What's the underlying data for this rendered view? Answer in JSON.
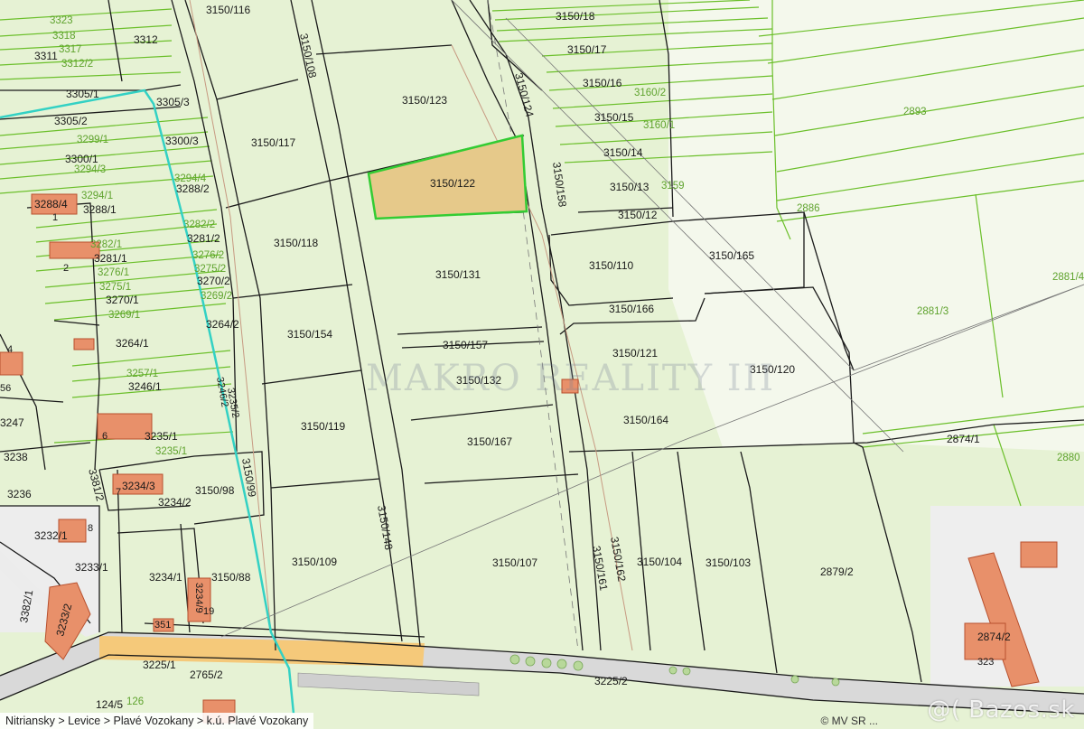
{
  "map": {
    "parcels": [
      {
        "id": "p-3150-116",
        "label": "3150/116"
      },
      {
        "id": "p-3150-108",
        "label": "3150/108"
      },
      {
        "id": "p-3150-123",
        "label": "3150/123"
      },
      {
        "id": "p-3150-122",
        "label": "3150/122",
        "highlighted": true
      },
      {
        "id": "p-3150-117",
        "label": "3150/117"
      },
      {
        "id": "p-3150-118",
        "label": "3150/118"
      },
      {
        "id": "p-3150-131",
        "label": "3150/131"
      },
      {
        "id": "p-3150-154",
        "label": "3150/154"
      },
      {
        "id": "p-3150-157",
        "label": "3150/157"
      },
      {
        "id": "p-3150-132",
        "label": "3150/132"
      },
      {
        "id": "p-3150-119",
        "label": "3150/119"
      },
      {
        "id": "p-3150-167",
        "label": "3150/167"
      },
      {
        "id": "p-3150-109",
        "label": "3150/109"
      },
      {
        "id": "p-3150-148",
        "label": "3150/148"
      },
      {
        "id": "p-3150-107",
        "label": "3150/107"
      },
      {
        "id": "p-3150-161",
        "label": "3150/161"
      },
      {
        "id": "p-3150-162",
        "label": "3150/162"
      },
      {
        "id": "p-3150-104",
        "label": "3150/104"
      },
      {
        "id": "p-3150-103",
        "label": "3150/103"
      },
      {
        "id": "p-3150-124",
        "label": "3150/124"
      },
      {
        "id": "p-3150-158",
        "label": "3150/158"
      },
      {
        "id": "p-3150-18",
        "label": "3150/18"
      },
      {
        "id": "p-3150-17",
        "label": "3150/17"
      },
      {
        "id": "p-3150-16",
        "label": "3150/16"
      },
      {
        "id": "p-3150-15",
        "label": "3150/15"
      },
      {
        "id": "p-3150-14",
        "label": "3150/14"
      },
      {
        "id": "p-3150-13",
        "label": "3150/13"
      },
      {
        "id": "p-3150-12",
        "label": "3150/12"
      },
      {
        "id": "p-3150-110",
        "label": "3150/110"
      },
      {
        "id": "p-3150-165",
        "label": "3150/165"
      },
      {
        "id": "p-3150-166",
        "label": "3150/166"
      },
      {
        "id": "p-3150-121",
        "label": "3150/121"
      },
      {
        "id": "p-3150-120",
        "label": "3150/120"
      },
      {
        "id": "p-3150-164",
        "label": "3150/164"
      },
      {
        "id": "p-3150-98",
        "label": "3150/98"
      },
      {
        "id": "p-3150-99",
        "label": "3150/99"
      },
      {
        "id": "p-3150-88",
        "label": "3150/88"
      },
      {
        "id": "p-2874-1",
        "label": "2874/1"
      },
      {
        "id": "p-2879-2",
        "label": "2879/2"
      },
      {
        "id": "p-2874-2",
        "label": "2874/2"
      },
      {
        "id": "p-3312",
        "label": "3312"
      },
      {
        "id": "p-3311",
        "label": "3311"
      },
      {
        "id": "p-3305-1",
        "label": "3305/1"
      },
      {
        "id": "p-3305-2",
        "label": "3305/2"
      },
      {
        "id": "p-3305-3",
        "label": "3305/3"
      },
      {
        "id": "p-3300-3",
        "label": "3300/3"
      },
      {
        "id": "p-3300-1",
        "label": "3300/1"
      },
      {
        "id": "p-3288-2",
        "label": "3288/2"
      },
      {
        "id": "p-3288-4",
        "label": "3288/4"
      },
      {
        "id": "p-3288-1",
        "label": "3288/1"
      },
      {
        "id": "p-3281-2",
        "label": "3281/2"
      },
      {
        "id": "p-3281-1",
        "label": "3281/1"
      },
      {
        "id": "p-3270-2",
        "label": "3270/2"
      },
      {
        "id": "p-3270-1",
        "label": "3270/1"
      },
      {
        "id": "p-3264-2",
        "label": "3264/2"
      },
      {
        "id": "p-3264-1",
        "label": "3264/1"
      },
      {
        "id": "p-3246-1",
        "label": "3246/1"
      },
      {
        "id": "p-3246-2",
        "label": "3246/2"
      },
      {
        "id": "p-3235-2",
        "label": "3235/2"
      },
      {
        "id": "p-3235-1",
        "label": "3235/1"
      },
      {
        "id": "p-3247",
        "label": "3247"
      },
      {
        "id": "p-3238",
        "label": "3238"
      },
      {
        "id": "p-3236",
        "label": "3236"
      },
      {
        "id": "p-3234-3",
        "label": "3234/3"
      },
      {
        "id": "p-3234-2",
        "label": "3234/2"
      },
      {
        "id": "p-3234-1",
        "label": "3234/1"
      },
      {
        "id": "p-3232-1",
        "label": "3232/1"
      },
      {
        "id": "p-3233-1",
        "label": "3233/1"
      },
      {
        "id": "p-3233-2",
        "label": "3233/2"
      },
      {
        "id": "p-3382-1",
        "label": "3382/1"
      },
      {
        "id": "p-3381-2",
        "label": "3381/2"
      },
      {
        "id": "p-3225-1",
        "label": "3225/1"
      },
      {
        "id": "p-3225-2",
        "label": "3225/2"
      },
      {
        "id": "p-2765-2",
        "label": "2765/2"
      },
      {
        "id": "p-124-5",
        "label": "124/5"
      },
      {
        "id": "p-351",
        "label": "351"
      },
      {
        "id": "p-3234-9",
        "label": "3234/9"
      }
    ],
    "green_labels": [
      {
        "id": "g-3323",
        "label": "3323"
      },
      {
        "id": "g-3318",
        "label": "3318"
      },
      {
        "id": "g-3317",
        "label": "3317"
      },
      {
        "id": "g-3312-2",
        "label": "3312/2"
      },
      {
        "id": "g-3299-1",
        "label": "3299/1"
      },
      {
        "id": "g-3294-3",
        "label": "3294/3"
      },
      {
        "id": "g-3294-4",
        "label": "3294/4"
      },
      {
        "id": "g-3294-1",
        "label": "3294/1"
      },
      {
        "id": "g-3282-2",
        "label": "3282/2"
      },
      {
        "id": "g-3282-1",
        "label": "3282/1"
      },
      {
        "id": "g-3276-2",
        "label": "3276/2"
      },
      {
        "id": "g-3276-1",
        "label": "3276/1"
      },
      {
        "id": "g-3275-2",
        "label": "3275/2"
      },
      {
        "id": "g-3275-1",
        "label": "3275/1"
      },
      {
        "id": "g-3269-2",
        "label": "3269/2"
      },
      {
        "id": "g-3269-1",
        "label": "3269/1"
      },
      {
        "id": "g-3257-1",
        "label": "3257/1"
      },
      {
        "id": "g-3235-1",
        "label": "3235/1"
      },
      {
        "id": "g-3159",
        "label": "3159"
      },
      {
        "id": "g-3160-2",
        "label": "3160/2"
      },
      {
        "id": "g-3160-1",
        "label": "3160/1"
      },
      {
        "id": "g-2893",
        "label": "2893"
      },
      {
        "id": "g-2886",
        "label": "2886"
      },
      {
        "id": "g-2881-3",
        "label": "2881/3"
      },
      {
        "id": "g-2881-4",
        "label": "2881/4"
      },
      {
        "id": "g-2880",
        "label": "2880"
      },
      {
        "id": "g-126",
        "label": "126"
      }
    ],
    "building_numbers": [
      "1",
      "2",
      "4",
      "56",
      "6",
      "7",
      "8",
      "19",
      "323"
    ],
    "colors": {
      "background": "#e6f2d4",
      "parcel_line": "#1a1a1a",
      "land_line": "#6bbf2a",
      "highlight_fill": "#e6c98a",
      "highlight_stroke": "#33cc33",
      "boundary": "#33d1c4",
      "building": "#e8906a",
      "road": "#d6d6d6",
      "sand": "#f5c97a"
    }
  },
  "watermarks": {
    "makro": "MAKRO REALITY III",
    "bazos": "@( Bazos.sk"
  },
  "footer": {
    "breadcrumb": "Nitriansky > Levice > Plavé Vozokany > k.ú. Plavé Vozokany",
    "attribution": "© MV SR ..."
  }
}
